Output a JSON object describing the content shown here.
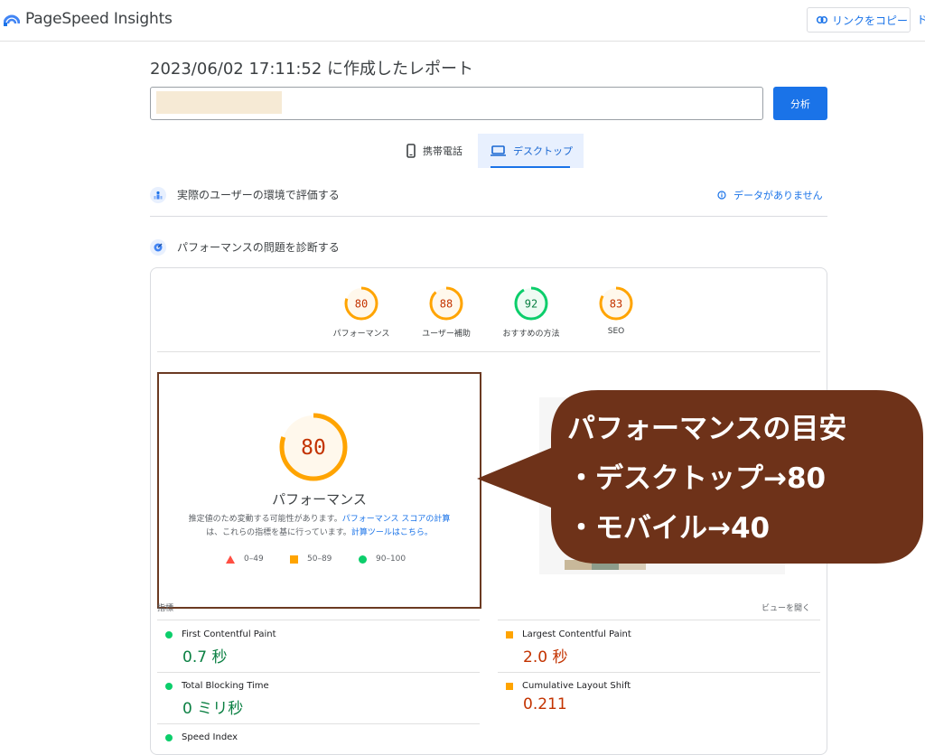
{
  "header": {
    "app_title": "PageSpeed Insights",
    "copy_link_label": "リンクをコピー",
    "cut_off_label": "ド"
  },
  "report": {
    "title": "2023/06/02 17:11:52 に作成したレポート",
    "analyze_label": "分析"
  },
  "device_tabs": [
    {
      "label": "携帯電話",
      "icon": "phone-icon",
      "selected": false
    },
    {
      "label": "デスクトップ",
      "icon": "laptop-icon",
      "selected": true
    }
  ],
  "field_section": {
    "title": "実際のユーザーの環境で評価する",
    "no_data_label": "データがありません"
  },
  "lab_section": {
    "title": "パフォーマンスの問題を診断する"
  },
  "categories": [
    {
      "label": "パフォーマンス",
      "score": 80
    },
    {
      "label": "ユーザー補助",
      "score": 88
    },
    {
      "label": "おすすめの方法",
      "score": 92
    },
    {
      "label": "SEO",
      "score": 83
    }
  ],
  "performance": {
    "score": 80,
    "label": "パフォーマンス",
    "note_prefix": "推定値のため変動する可能性があります。",
    "note_link1": "パフォーマンス スコアの計算",
    "note_middle": "は、これらの指標を基に行っています。",
    "note_link2": "計算ツールはこちら。",
    "legend": [
      {
        "range": "0–49",
        "shape": "triangle",
        "color": "#ff4e42"
      },
      {
        "range": "50–89",
        "shape": "square",
        "color": "#ffa400"
      },
      {
        "range": "90–100",
        "shape": "circle",
        "color": "#0cce6b"
      }
    ]
  },
  "callout": {
    "line1": "パフォーマンスの目安",
    "line2": "・デスクトップ→80",
    "line3": "・モバイル→40",
    "color": "#6e3219"
  },
  "metrics": {
    "label": "指標",
    "toggle_label": "ビューを開く",
    "items": [
      {
        "name": "First Contentful Paint",
        "value": "0.7 秒",
        "status": "good"
      },
      {
        "name": "Largest Contentful Paint",
        "value": "2.0 秒",
        "status": "average"
      },
      {
        "name": "Total Blocking Time",
        "value": "0 ミリ秒",
        "status": "good"
      },
      {
        "name": "Cumulative Layout Shift",
        "value": "0.211",
        "status": "average"
      },
      {
        "name": "Speed Index",
        "value": "",
        "status": "good"
      }
    ]
  },
  "colors": {
    "accent": "#1a73e8",
    "good": "#0cce6b",
    "average": "#ffa400",
    "poor": "#ff4e42"
  }
}
